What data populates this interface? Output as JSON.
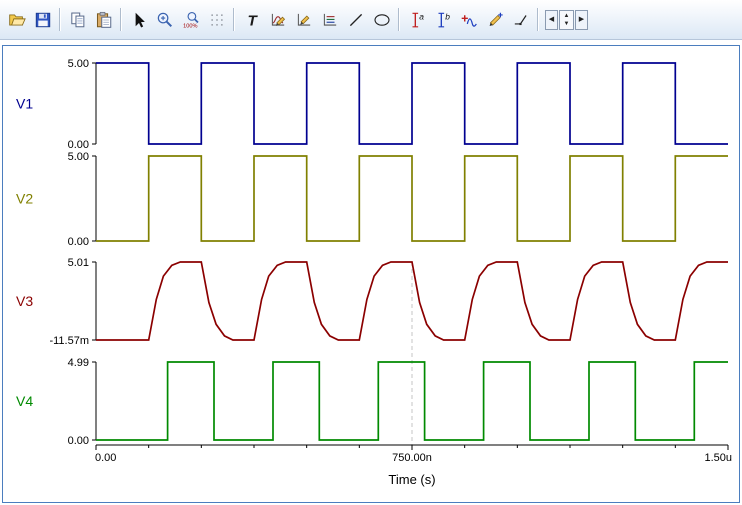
{
  "toolbar": {
    "items": [
      "open",
      "save",
      "copy",
      "paste",
      "select-cursor",
      "zoom-in",
      "zoom-100",
      "grid",
      "text",
      "edit-waveform",
      "edit-axis",
      "legend",
      "line",
      "ellipse",
      "cursor-a",
      "cursor-b",
      "add-curve",
      "pen",
      "polyline",
      "prev-page",
      "page-spinner",
      "next-page"
    ],
    "zoom_100_label": "100%",
    "text_tool_label": "T",
    "cursor_a_label": "a",
    "cursor_b_label": "b",
    "prev_glyph": "◀",
    "next_glyph": "▶",
    "spinner_up_glyph": "▲",
    "spinner_down_glyph": "▼"
  },
  "chart_data": {
    "type": "line",
    "title": "",
    "xlabel": "Time (s)",
    "x_unit": "us",
    "x_range": [
      0,
      1.5
    ],
    "x_ticks": [
      {
        "value": 0,
        "label": "0.00"
      },
      {
        "value": 0.75,
        "label": "750.00n"
      },
      {
        "value": 1.5,
        "label": "1.50u"
      }
    ],
    "cursor": {
      "x": 0.75,
      "style": "dashed"
    },
    "grid": false,
    "plots": [
      {
        "name": "V1",
        "color": "#000090",
        "y_min": 0,
        "y_max": 5,
        "y_top_label": "5.00",
        "y_bottom_label": "0.00",
        "points": [
          [
            0,
            5
          ],
          [
            0.125,
            5
          ],
          [
            0.125,
            0
          ],
          [
            0.25,
            0
          ],
          [
            0.25,
            5
          ],
          [
            0.375,
            5
          ],
          [
            0.375,
            0
          ],
          [
            0.5,
            0
          ],
          [
            0.5,
            5
          ],
          [
            0.625,
            5
          ],
          [
            0.625,
            0
          ],
          [
            0.75,
            0
          ],
          [
            0.75,
            5
          ],
          [
            0.875,
            5
          ],
          [
            0.875,
            0
          ],
          [
            1,
            0
          ],
          [
            1,
            5
          ],
          [
            1.125,
            5
          ],
          [
            1.125,
            0
          ],
          [
            1.25,
            0
          ],
          [
            1.25,
            5
          ],
          [
            1.375,
            5
          ],
          [
            1.375,
            0
          ],
          [
            1.5,
            0
          ]
        ]
      },
      {
        "name": "V2",
        "color": "#808000",
        "y_min": 0,
        "y_max": 5,
        "y_top_label": "5.00",
        "y_bottom_label": "0.00",
        "points": [
          [
            0,
            0
          ],
          [
            0.125,
            0
          ],
          [
            0.125,
            5
          ],
          [
            0.25,
            5
          ],
          [
            0.25,
            0
          ],
          [
            0.375,
            0
          ],
          [
            0.375,
            5
          ],
          [
            0.5,
            5
          ],
          [
            0.5,
            0
          ],
          [
            0.625,
            0
          ],
          [
            0.625,
            5
          ],
          [
            0.75,
            5
          ],
          [
            0.75,
            0
          ],
          [
            0.875,
            0
          ],
          [
            0.875,
            5
          ],
          [
            1,
            5
          ],
          [
            1,
            0
          ],
          [
            1.125,
            0
          ],
          [
            1.125,
            5
          ],
          [
            1.25,
            5
          ],
          [
            1.25,
            0
          ],
          [
            1.375,
            0
          ],
          [
            1.375,
            5
          ],
          [
            1.5,
            5
          ]
        ]
      },
      {
        "name": "V3",
        "color": "#8b0000",
        "y_min": -0.012,
        "y_max": 5.01,
        "y_top_label": "5.01",
        "y_bottom_label": "-11.57m",
        "points": [
          [
            0,
            -0.012
          ],
          [
            0.125,
            -0.012
          ],
          [
            0.143,
            2.6
          ],
          [
            0.16,
            4.1
          ],
          [
            0.18,
            4.8
          ],
          [
            0.2,
            5.01
          ],
          [
            0.25,
            5.01
          ],
          [
            0.268,
            2.4
          ],
          [
            0.285,
            1.0
          ],
          [
            0.305,
            0.25
          ],
          [
            0.325,
            -0.012
          ],
          [
            0.375,
            -0.012
          ],
          [
            0.393,
            2.6
          ],
          [
            0.41,
            4.1
          ],
          [
            0.43,
            4.8
          ],
          [
            0.45,
            5.01
          ],
          [
            0.5,
            5.01
          ],
          [
            0.518,
            2.4
          ],
          [
            0.535,
            1.0
          ],
          [
            0.555,
            0.25
          ],
          [
            0.575,
            -0.012
          ],
          [
            0.625,
            -0.012
          ],
          [
            0.643,
            2.6
          ],
          [
            0.66,
            4.1
          ],
          [
            0.68,
            4.8
          ],
          [
            0.7,
            5.01
          ],
          [
            0.75,
            5.01
          ],
          [
            0.768,
            2.4
          ],
          [
            0.785,
            1.0
          ],
          [
            0.805,
            0.25
          ],
          [
            0.825,
            -0.012
          ],
          [
            0.875,
            -0.012
          ],
          [
            0.893,
            2.6
          ],
          [
            0.91,
            4.1
          ],
          [
            0.93,
            4.8
          ],
          [
            0.95,
            5.01
          ],
          [
            1,
            5.01
          ],
          [
            1.018,
            2.4
          ],
          [
            1.035,
            1.0
          ],
          [
            1.055,
            0.25
          ],
          [
            1.075,
            -0.012
          ],
          [
            1.125,
            -0.012
          ],
          [
            1.143,
            2.6
          ],
          [
            1.16,
            4.1
          ],
          [
            1.18,
            4.8
          ],
          [
            1.2,
            5.01
          ],
          [
            1.25,
            5.01
          ],
          [
            1.268,
            2.4
          ],
          [
            1.285,
            1.0
          ],
          [
            1.305,
            0.25
          ],
          [
            1.325,
            -0.012
          ],
          [
            1.375,
            -0.012
          ],
          [
            1.393,
            2.6
          ],
          [
            1.41,
            4.1
          ],
          [
            1.43,
            4.8
          ],
          [
            1.45,
            5.01
          ],
          [
            1.5,
            5.01
          ]
        ]
      },
      {
        "name": "V4",
        "color": "#008a00",
        "y_min": 0,
        "y_max": 4.99,
        "y_top_label": "4.99",
        "y_bottom_label": "0.00",
        "points": [
          [
            0,
            0
          ],
          [
            0.17,
            0
          ],
          [
            0.17,
            4.99
          ],
          [
            0.28,
            4.99
          ],
          [
            0.28,
            0
          ],
          [
            0.42,
            0
          ],
          [
            0.42,
            4.99
          ],
          [
            0.53,
            4.99
          ],
          [
            0.53,
            0
          ],
          [
            0.67,
            0
          ],
          [
            0.67,
            4.99
          ],
          [
            0.78,
            4.99
          ],
          [
            0.78,
            0
          ],
          [
            0.92,
            0
          ],
          [
            0.92,
            4.99
          ],
          [
            1.03,
            4.99
          ],
          [
            1.03,
            0
          ],
          [
            1.17,
            0
          ],
          [
            1.17,
            4.99
          ],
          [
            1.28,
            4.99
          ],
          [
            1.28,
            0
          ],
          [
            1.42,
            0
          ],
          [
            1.42,
            4.99
          ],
          [
            1.5,
            4.99
          ]
        ]
      }
    ]
  }
}
